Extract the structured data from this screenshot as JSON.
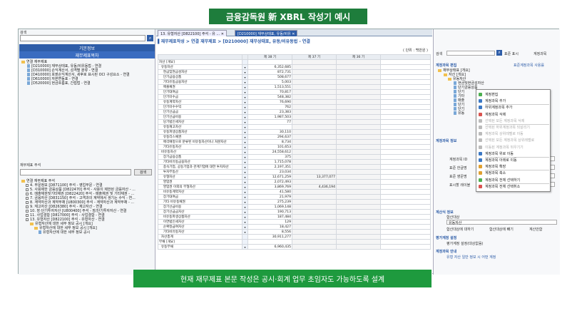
{
  "banner": "금융감독원 新 XBRL 작성기 예시",
  "caption": "현재 재무제표 본문 작성은 공시·회계 업무 초임자도 가능하도록 설계",
  "left": {
    "search_label": "검색",
    "section1": "기본정보",
    "section2": "재무제표목차",
    "tree1": [
      "연결 재무제표",
      "[D210000] 재무상태표, 유동/비유동법 - 연결",
      "[D310000] 손익계산서, 성격별 분류 - 연결",
      "[D410000] 포괄손익계산서, 세후로 표시된 OCI 구성요소 - 연결",
      "[D610000] 자본변동표 - 연결",
      "[D520000] 현금흐름표, 간접법 - 연결"
    ],
    "notes_label": "재무제표 주석",
    "notes_search_btn": "검색",
    "tree2": [
      "연결 재무제표 주석",
      "4. 부문정보 [D871100] 주석 - 영업부문 - 연결",
      "5. 사용제한 금융상품 [D822470] 주석 - 사용이 제한된 금융자산 - ...",
      "6. 매출채권및기타채권 [D822420] 주석 - 매출채권 및 기타채권 - ...",
      "7. 금융자산 [D831150] 주석 - 고객과의 계약에서 생기는 수익 - 연...",
      "8. 계약자산과 계약부채 [U800300] 주석 - 계약자산과 계약부채 - ...",
      "9. 재고자산 [D826380] 주석 - 재고자산 - 연결",
      "10. 장·단기투자자산 [U800400] 주석 - 장/단기투자자산 - 연결",
      "11. 사업결합 [D817000] 주석 - 사업결합 - 연결",
      "13. 유형자산 [D822100] 주석 - 유형자산 - 연결",
      "유형자산에 대한 세부 정보 공시 [개요]",
      "유형자산에 대한 세부 정보 공시 [개요]",
      "유형자산에 대한 세부 정보 공시"
    ]
  },
  "center": {
    "tab1": "13. 유형자산 [D822100] 주석 - 유 ... ✕",
    "tab2": "[D210000] 재무상태표, 유동/비유 ✕",
    "breadcrumb": "▌재무제표작성 > 연결 재무제표 > [D210000] 재무상태표, 유동/비유동법 - 연결",
    "unit": "( 단위 : 백만원 )",
    "col_headers": [
      "",
      "",
      "제 38 기",
      "제 37 기",
      "제 36 기"
    ],
    "rows": [
      [
        "자산 [개요]",
        "",
        "",
        "",
        ""
      ],
      [
        "  유동자산",
        "▾",
        "6,352,685",
        "",
        ""
      ],
      [
        "    현금및현금성자산",
        "▾",
        "872,731",
        "",
        ""
      ],
      [
        "    단기금융상품",
        "▾",
        "508,677",
        "",
        ""
      ],
      [
        "    기타유동금융자산",
        "▾",
        "5,003",
        "",
        ""
      ],
      [
        "    매출채권",
        "▾",
        "1,513,551",
        "",
        ""
      ],
      [
        "    단기대여금",
        "▾",
        "70,817",
        "",
        ""
      ],
      [
        "    단기미수금",
        "▾",
        "548,382",
        "",
        ""
      ],
      [
        "    유동계약자산",
        "▾",
        "76,690",
        "",
        ""
      ],
      [
        "    단기미수수익",
        "▾",
        "762",
        "",
        ""
      ],
      [
        "    단기선급금",
        "▾",
        "23,383",
        "",
        ""
      ],
      [
        "    단기선급비용",
        "▾",
        "1,987,503",
        "",
        ""
      ],
      [
        "    당기법인세자산",
        "▾",
        "77",
        "",
        ""
      ],
      [
        "    유동재고자산",
        "▾",
        "",
        "",
        ""
      ],
      [
        "    유동파생상품자산",
        "▾",
        "30,110",
        "",
        ""
      ],
      [
        "    유동리스채권",
        "▾",
        "294,637",
        "",
        ""
      ],
      [
        "    매각예정으로 분류된 비유동자산이나 처분자산",
        "▾",
        "8,734",
        "",
        ""
      ],
      [
        "    기타유동자산",
        "▾",
        "101,653",
        "",
        ""
      ],
      [
        "  비유동자산",
        "▾",
        "24,558,612",
        "",
        ""
      ],
      [
        "    장기금융상품",
        "▾",
        "375",
        "",
        ""
      ],
      [
        "    기타비유동금융자산",
        "▾",
        "1,715,078",
        "",
        ""
      ],
      [
        "    종속기업, 공동기업과 관계기업에 대한 투자자산",
        "▾",
        "2,197,351",
        "",
        ""
      ],
      [
        "    투자부동산",
        "▾",
        "23,034",
        "",
        ""
      ],
      [
        "    유형자산",
        "▾",
        "12,671,259",
        "13,377,077",
        ""
      ],
      [
        "    영업권",
        "▾",
        "2,072,493",
        "",
        ""
      ],
      [
        "    영업권 이외의 무형자산",
        "▾",
        "3,869,769",
        "4,436,194",
        ""
      ],
      [
        "    비유동계약자산",
        "▾",
        "41,580",
        "",
        ""
      ],
      [
        "    장기대여금",
        "▾",
        "21,979",
        "",
        ""
      ],
      [
        "    기타 비유동채권",
        "▾",
        "275,239",
        "",
        ""
      ],
      [
        "    장기선급비용",
        "▾",
        "1,069,148",
        "",
        ""
      ],
      [
        "    장기선급금자산",
        "▾",
        "190,713",
        "",
        ""
      ],
      [
        "    비유동파생상품자산",
        "▾",
        "187,484",
        "",
        ""
      ],
      [
        "    이연법인세자산",
        "▾",
        "129",
        "",
        ""
      ],
      [
        "    순확정급여자산",
        "▾",
        "18,427",
        "",
        ""
      ],
      [
        "    기타비유동자산",
        "▾",
        "8,556",
        "",
        ""
      ],
      [
        "  자산총계",
        "",
        "30,911,277",
        "",
        ""
      ],
      [
        "부채 [개요]",
        "",
        "",
        "",
        ""
      ],
      [
        "  유동부채",
        "▾",
        "6,960,435",
        "",
        ""
      ]
    ]
  },
  "right": {
    "search_label": "검색",
    "chk1": "표준 표시",
    "chk2": "계정과목",
    "edit_title": "계정과목 편집",
    "edit_sub": "표준계정과목 사용률",
    "tree": [
      "재무상태표 [개요]",
      "자산 [개요]",
      "유동자산",
      "현금및현금성자산",
      "단기금융상품",
      "단기",
      "기타",
      "매출",
      "단기",
      "단기",
      "유동"
    ],
    "info_title": "계정과목 정보",
    "fields": [
      "계정과목 ID",
      "표준 한글명",
      "표준 영문명",
      "표시할 레이블"
    ],
    "calc_title": "계산식 정보",
    "calc_sub": "합산대상",
    "calc_item": "유동자산",
    "radio1": "합산대상에 대하기",
    "radio2": "합산대상에 빼기",
    "radio3": "계산안함",
    "eval_title": "평가계정 설정",
    "eval_item": "평가계정 설정(대상없음)",
    "guide_title": "계정과목 안내",
    "guide_item": "유형 자산 일반 정보 시 어떤 계정",
    "menu": [
      {
        "label": "계정편집",
        "dis": false,
        "c": "#4caf50"
      },
      {
        "label": "계정과목 추가",
        "dis": false,
        "c": "#3b78c4"
      },
      {
        "label": "하위계정과목 추가",
        "dis": false,
        "c": "#3b78c4"
      },
      {
        "label": "계정과목 삭제",
        "dis": false,
        "c": "#d9534f"
      },
      {
        "label": "선택된 모든 계정과목 삭제",
        "dis": true,
        "c": "#bbb"
      },
      {
        "label": "선택된 하위계정과목 되살리기",
        "dis": true,
        "c": "#bbb"
      },
      {
        "label": "계정과목 상위레벨로 이동",
        "dis": true,
        "c": "#bbb"
      },
      {
        "label": "선택된 모든 계정과목 상위레벨로",
        "dis": true,
        "c": "#bbb"
      },
      {
        "label": "이동된 계정과목 뒤우기기",
        "dis": true,
        "c": "#bbb"
      },
      {
        "label": "계정과목 위로 이동",
        "dis": false,
        "c": "#3b78c4"
      },
      {
        "label": "계정과목 아래로 이동",
        "dis": false,
        "c": "#3b78c4"
      },
      {
        "label": "계정과목 확장",
        "dis": false,
        "c": "#e0a030"
      },
      {
        "label": "계정과목 축소",
        "dis": false,
        "c": "#e0a030"
      },
      {
        "label": "계정과목 전체 선택하기",
        "dis": false,
        "c": "#4caf50"
      },
      {
        "label": "계정과목 전체 선택취소",
        "dis": false,
        "c": "#d9534f"
      }
    ]
  }
}
